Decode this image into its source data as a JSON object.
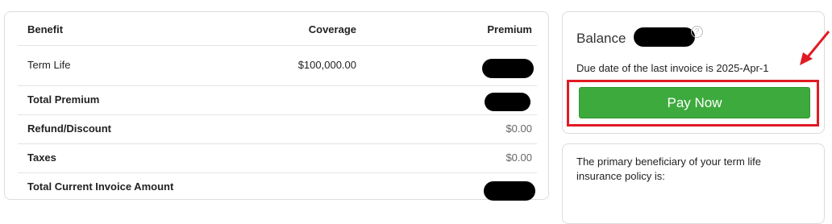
{
  "invoice": {
    "headers": {
      "benefit": "Benefit",
      "coverage": "Coverage",
      "premium": "Premium"
    },
    "rows": [
      {
        "label": "Term Life",
        "coverage": "$100,000.00",
        "premium": ""
      },
      {
        "label": "Total Premium",
        "premium": ""
      },
      {
        "label": "Refund/Discount",
        "premium": "$0.00"
      },
      {
        "label": "Taxes",
        "premium": "$0.00"
      },
      {
        "label": "Total Current Invoice Amount",
        "premium": ""
      }
    ]
  },
  "balance": {
    "title": "Balance",
    "help_symbol": "?",
    "due_text": "Due date of the last invoice is 2025-Apr-1",
    "pay_button_label": "Pay Now"
  },
  "beneficiary": {
    "text": "The primary beneficiary of your term life insurance policy is:"
  },
  "colors": {
    "pay_button": "#3daa3d",
    "highlight": "#e01b24",
    "redaction": "#000000"
  }
}
